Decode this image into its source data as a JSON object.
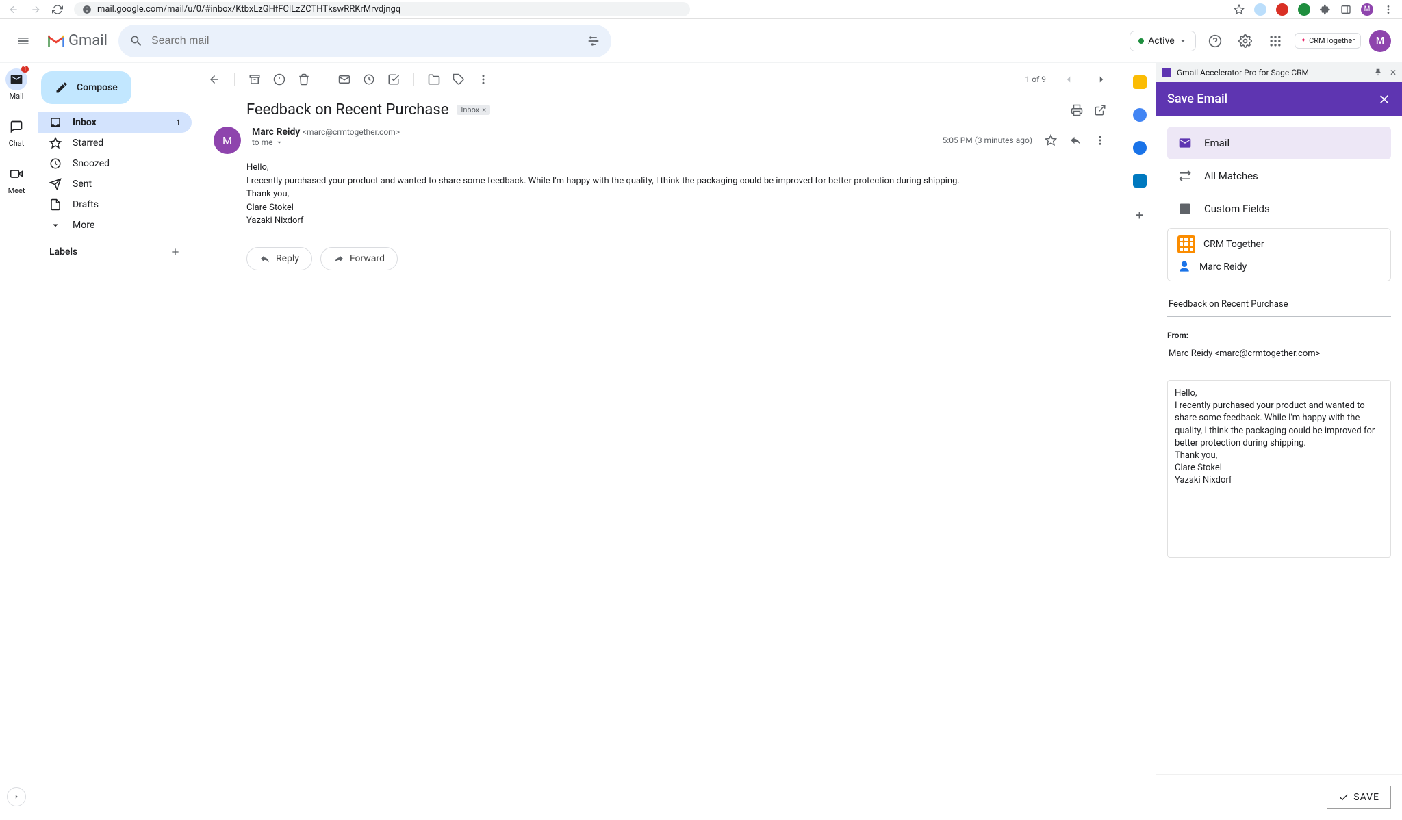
{
  "browser": {
    "url": "mail.google.com/mail/u/0/#inbox/KtbxLzGHfFClLzZCTHTkswRRKrMrvdjngq"
  },
  "header": {
    "logo_text": "Gmail",
    "search_placeholder": "Search mail",
    "active_label": "Active",
    "avatar_letter": "M",
    "ext_badge": "CRMTogether"
  },
  "left_rail": {
    "mail": "Mail",
    "mail_badge": "1",
    "chat": "Chat",
    "meet": "Meet"
  },
  "sidebar": {
    "compose": "Compose",
    "items": [
      {
        "label": "Inbox",
        "count": "1"
      },
      {
        "label": "Starred"
      },
      {
        "label": "Snoozed"
      },
      {
        "label": "Sent"
      },
      {
        "label": "Drafts"
      },
      {
        "label": "More"
      }
    ],
    "labels_header": "Labels"
  },
  "message": {
    "pager": "1 of 9",
    "subject": "Feedback on Recent Purchase",
    "inbox_chip": "Inbox",
    "sender_name": "Marc Reidy",
    "sender_email": "<marc@crmtogether.com>",
    "timestamp": "5:05 PM (3 minutes ago)",
    "to_line": "to me",
    "avatar_letter": "M",
    "body_l1": "Hello,",
    "body_l2": "I recently purchased your product and wanted to share some feedback. While I'm happy with the quality, I think the packaging could be improved for better protection during shipping.",
    "body_l3": "Thank you,",
    "body_l4": "Clare Stokel",
    "body_l5": "Yazaki Nixdorf",
    "reply": "Reply",
    "forward": "Forward"
  },
  "extension": {
    "title_bar": "Gmail Accelerator Pro for Sage CRM",
    "header": "Save Email",
    "tabs": {
      "email": "Email",
      "all_matches": "All Matches",
      "custom_fields": "Custom Fields"
    },
    "company": "CRM Together",
    "person": "Marc Reidy",
    "subject_field": "Feedback on Recent Purchase",
    "from_label": "From:",
    "from_value": "Marc Reidy <marc@crmtogether.com>",
    "body": "Hello,\nI recently purchased your product and wanted to share some feedback. While I'm happy with the quality, I think the packaging could be improved for better protection during shipping.\nThank you,\nClare Stokel\nYazaki Nixdorf",
    "save_button": "SAVE"
  }
}
